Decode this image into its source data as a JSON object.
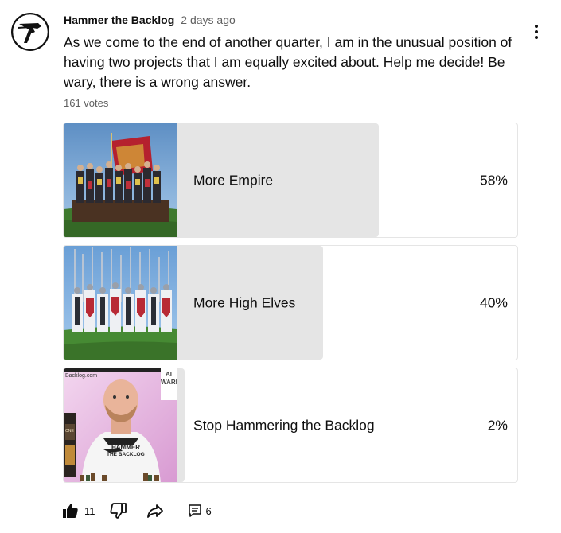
{
  "post": {
    "author": "Hammer the Backlog",
    "time": "2 days ago",
    "text": "As we come to the end of another quarter, I am in the unusual position of having two projects that I am equally excited about. Help me decide! Be wary, there is a wrong answer.",
    "votes": "161 votes"
  },
  "poll": {
    "options": [
      {
        "label": "More Empire",
        "percent": "58%",
        "share": 0.58,
        "thumb": "empire-miniatures-image"
      },
      {
        "label": "More High Elves",
        "percent": "40%",
        "share": 0.4,
        "thumb": "high-elves-miniatures-image"
      },
      {
        "label": "Stop Hammering the Backlog",
        "percent": "2%",
        "share": 0.02,
        "thumb": "presenter-video-thumbnail",
        "thumb_texts": {
          "site": "Backlog.com",
          "corner": "AI\nWARI",
          "shirt_top": "HAMMER",
          "shirt_bottom": "THE BACKLOG",
          "side": "ONE"
        }
      }
    ]
  },
  "actions": {
    "likes": "11",
    "comments": "6"
  },
  "colors": {
    "bar": "#e5e5e5",
    "border": "#e5e5e5",
    "text": "#0f0f0f",
    "muted": "#606060"
  }
}
